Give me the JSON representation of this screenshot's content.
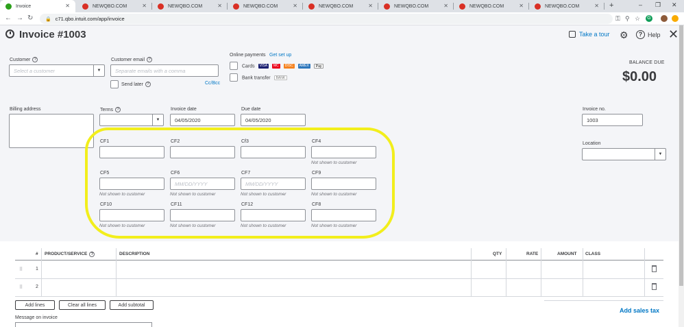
{
  "browser": {
    "tabs": [
      {
        "title": "Invoice",
        "active": true,
        "favicon": "qbo-green-icon"
      },
      {
        "title": "NEWQBO.COM",
        "active": false,
        "favicon": "red-circle-icon"
      },
      {
        "title": "NEWQBO.COM",
        "active": false,
        "favicon": "red-circle-icon"
      },
      {
        "title": "NEWQBO.COM",
        "active": false,
        "favicon": "red-circle-icon"
      },
      {
        "title": "NEWQBO.COM",
        "active": false,
        "favicon": "red-circle-icon"
      },
      {
        "title": "NEWQBO.COM",
        "active": false,
        "favicon": "red-circle-icon"
      },
      {
        "title": "NEWQBO.COM",
        "active": false,
        "favicon": "red-circle-icon"
      },
      {
        "title": "NEWQBO.COM",
        "active": false,
        "favicon": "red-circle-icon"
      }
    ],
    "url": "c71.qbo.intuit.com/app/invoice"
  },
  "header": {
    "title": "Invoice #1003",
    "take_tour": "Take a tour",
    "help": "Help"
  },
  "customer": {
    "label": "Customer",
    "placeholder": "Select a customer"
  },
  "email": {
    "label": "Customer email",
    "placeholder": "Separate emails with a comma",
    "send_later": "Send later",
    "cc_bcc": "Cc/Bcc"
  },
  "online_payments": {
    "label": "Online payments",
    "setup": "Get set up",
    "cards": "Cards",
    "bank_transfer": "Bank transfer",
    "card_brands": [
      "VISA",
      "MC",
      "DISC",
      "AMEX",
      "Pay"
    ],
    "bank_badge": "BANK"
  },
  "balance": {
    "label": "BALANCE DUE",
    "amount": "$0.00"
  },
  "billing_address": {
    "label": "Billing address"
  },
  "terms": {
    "label": "Terms"
  },
  "invoice_date": {
    "label": "Invoice date",
    "value": "04/05/2020"
  },
  "due_date": {
    "label": "Due date",
    "value": "04/05/2020"
  },
  "invoice_no": {
    "label": "Invoice no.",
    "value": "1003"
  },
  "location": {
    "label": "Location"
  },
  "custom_fields": {
    "hint": "Not shown to customer",
    "date_placeholder": "MM/DD/YYYY",
    "cf1": "CF1",
    "cf2": "CF2",
    "cf3": "Cf3",
    "cf4": "CF4",
    "cf5": "CF5",
    "cf6": "CF6",
    "cf7": "CF7",
    "cf9": "CF9",
    "cf10": "CF10",
    "cf11": "CF11",
    "cf12": "CF12",
    "cf8": "CF8"
  },
  "table": {
    "columns": {
      "num": "#",
      "product": "PRODUCT/SERVICE",
      "description": "DESCRIPTION",
      "qty": "QTY",
      "rate": "RATE",
      "amount": "AMOUNT",
      "class": "CLASS"
    },
    "rows": [
      "1",
      "2"
    ]
  },
  "actions": {
    "add_lines": "Add lines",
    "clear_all_lines": "Clear all lines",
    "add_subtotal": "Add subtotal",
    "add_sales_tax": "Add sales tax",
    "message_label": "Message on invoice"
  },
  "colors": {
    "link": "#0077c5",
    "highlight": "#f2ee1c",
    "background": "#f4f5f8"
  }
}
